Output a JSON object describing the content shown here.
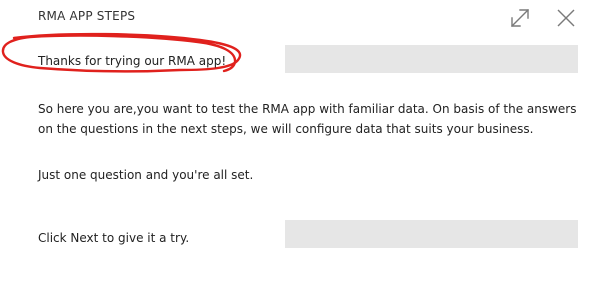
{
  "dialog": {
    "title": "RMA APP STEPS"
  },
  "header_icons": {
    "expand": "expand-icon",
    "close": "close-icon"
  },
  "content": {
    "intro": "Thanks for trying our RMA app!",
    "description": "So here you are,you want to test the RMA app with familiar data. On basis of the answers on the questions in the next steps, we will configure data that suits your business.",
    "question_note": "Just one question and you're all set.",
    "next_hint": "Click Next to give it a try."
  },
  "colors": {
    "annotation": "#e0211d",
    "placeholder": "#e6e6e6"
  }
}
